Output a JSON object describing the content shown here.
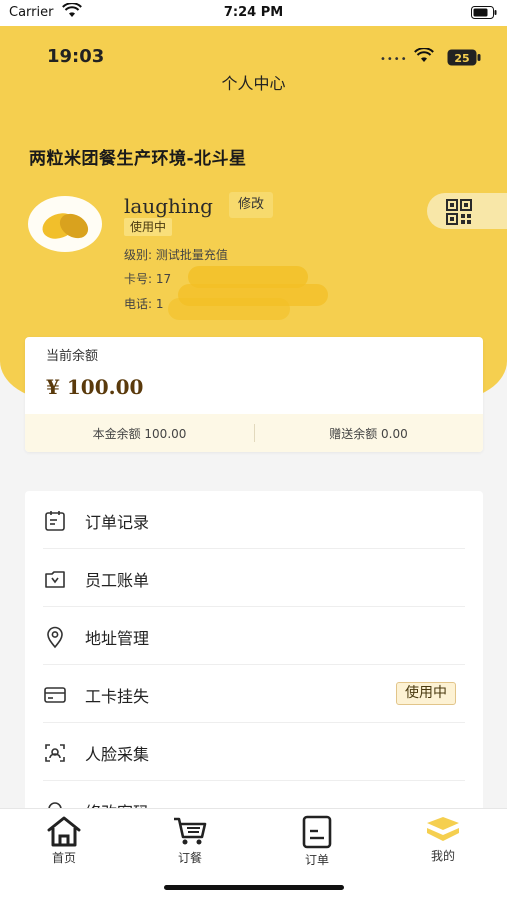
{
  "system_bar": {
    "carrier": "Carrier",
    "time": "7:24 PM"
  },
  "inner_status": {
    "time": "19:03",
    "signal_dots": "••••",
    "battery": "25"
  },
  "header": {
    "title": "个人中心"
  },
  "company": "两粒米团餐生产环境-北斗星",
  "profile": {
    "username": "laughing",
    "edit_label": "修改",
    "status": "使用中",
    "level_label": "级别:",
    "level_value": "测试批量充值",
    "card_label": "卡号:",
    "card_value": "17",
    "phone_label": "电话:",
    "phone_value": "1"
  },
  "balance": {
    "label": "当前余额",
    "amount": "¥ 100.00",
    "principal": "本金余额 100.00",
    "gift": "赠送余额 0.00"
  },
  "menu": [
    {
      "label": "订单记录",
      "icon": "calendar-icon"
    },
    {
      "label": "员工账单",
      "icon": "wallet-icon"
    },
    {
      "label": "地址管理",
      "icon": "location-pin-icon"
    },
    {
      "label": "工卡挂失",
      "icon": "card-icon",
      "badge": "使用中"
    },
    {
      "label": "人脸采集",
      "icon": "face-scan-icon"
    },
    {
      "label": "修改密码",
      "icon": "lock-icon"
    }
  ],
  "tabs": [
    {
      "label": "首页",
      "icon": "home-icon"
    },
    {
      "label": "订餐",
      "icon": "cart-icon"
    },
    {
      "label": "订单",
      "icon": "order-icon"
    },
    {
      "label": "我的",
      "icon": "mine-icon",
      "active": true
    }
  ],
  "colors": {
    "brand": "#f5cf4f",
    "accent_dark": "#5a3a0c"
  }
}
